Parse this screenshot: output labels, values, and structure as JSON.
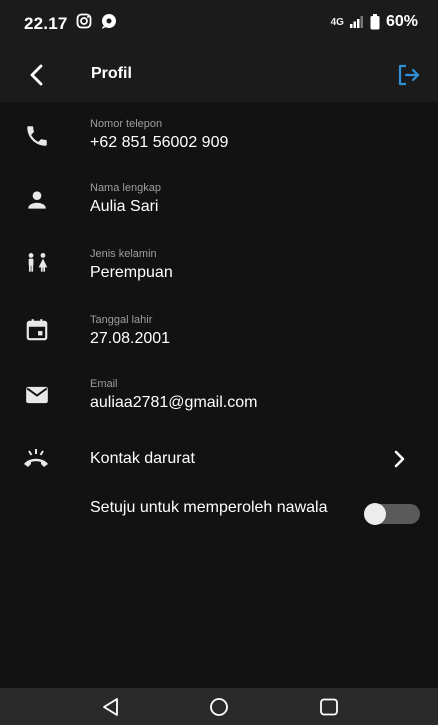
{
  "status_bar": {
    "time": "22.17",
    "signal_text": "4G",
    "battery": "60%",
    "icons": [
      "instagram-icon",
      "chat-bubble-icon",
      "signal-icon",
      "battery-icon"
    ]
  },
  "app_bar": {
    "title": "Profil",
    "back_icon": "back-arrow-icon",
    "action_icon": "logout-icon",
    "accent_color": "#2f8fd8"
  },
  "fields": [
    {
      "icon": "phone-icon",
      "label": "Nomor telepon",
      "value": "+62 851 56002 909"
    },
    {
      "icon": "person-icon",
      "label": "Nama lengkap",
      "value": "Aulia Sari"
    },
    {
      "icon": "gender-icon",
      "label": "Jenis kelamin",
      "value": "Perempuan"
    },
    {
      "icon": "calendar-icon",
      "label": "Tanggal lahir",
      "value": "27.08.2001"
    },
    {
      "icon": "mail-icon",
      "label": "Email",
      "value": "auliaa2781@gmail.com"
    }
  ],
  "emergency_contact": {
    "icon": "emergency-call-icon",
    "label": "Kontak darurat"
  },
  "newsletter": {
    "label": "Setuju untuk memperoleh nawala",
    "enabled": false
  },
  "nav_bar": {
    "buttons": [
      "back-triangle-icon",
      "home-circle-icon",
      "recents-square-icon"
    ]
  }
}
